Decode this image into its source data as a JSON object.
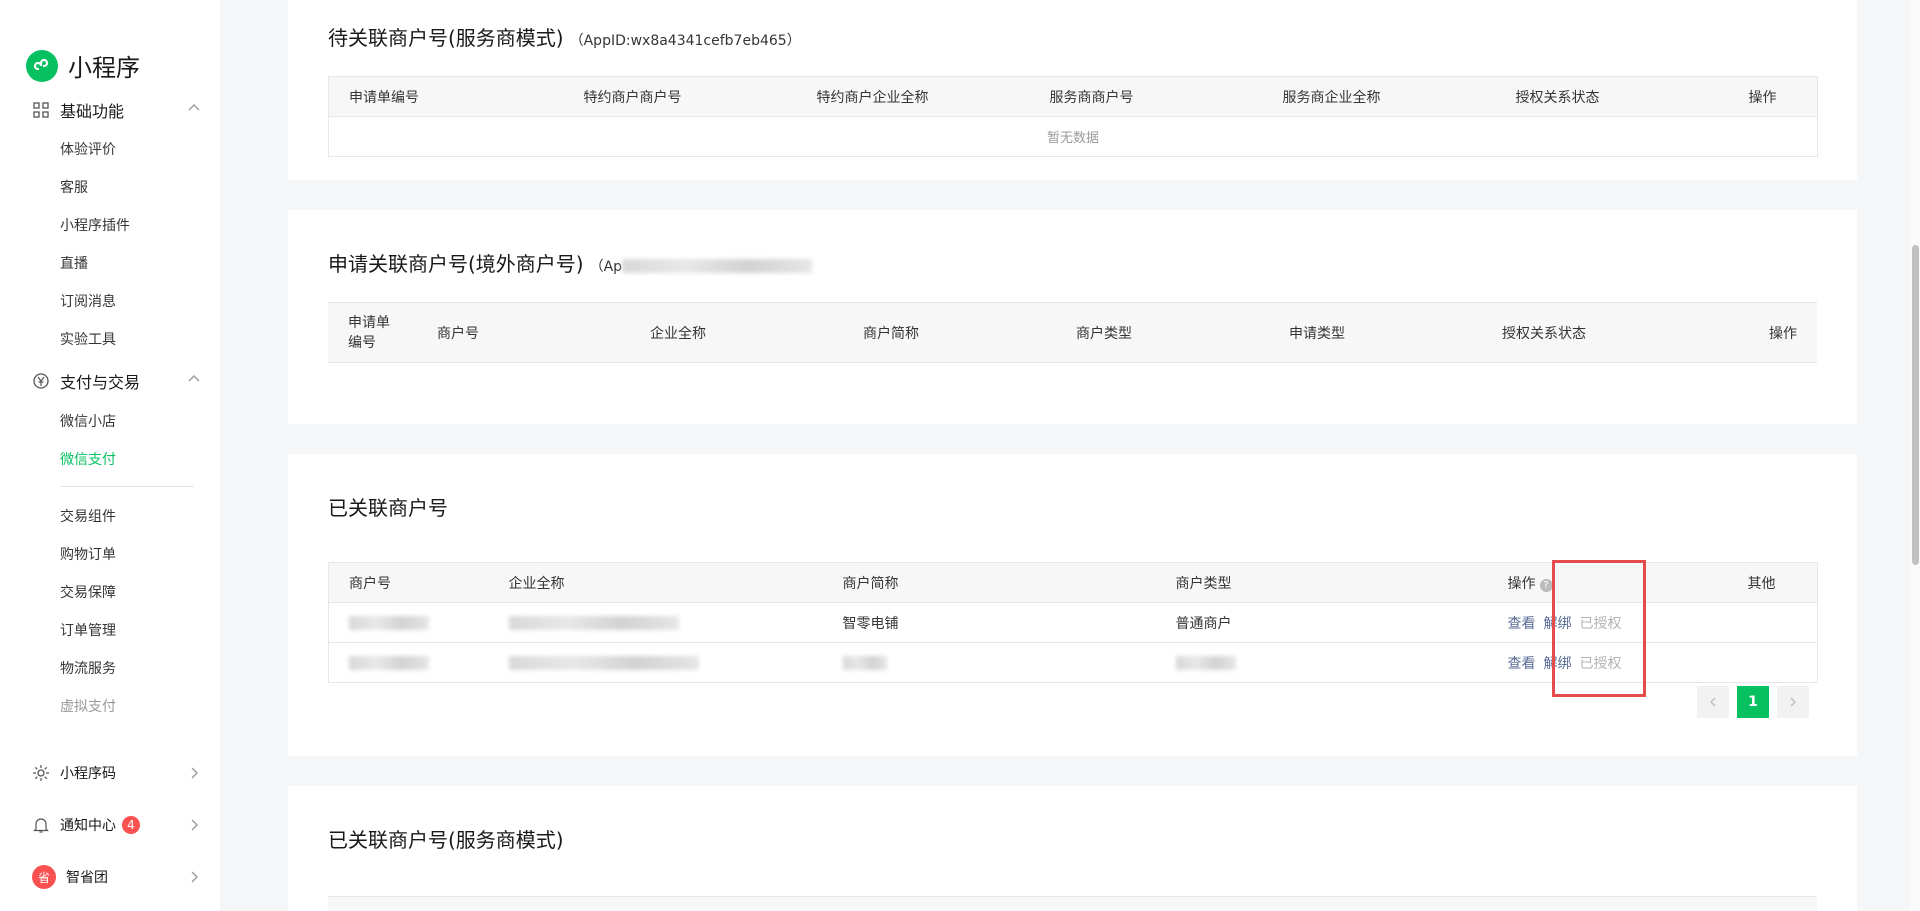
{
  "brand": {
    "title": "小程序"
  },
  "sidebar": {
    "group_basic": {
      "label": "基础功能",
      "items": [
        "体验评价",
        "客服",
        "小程序插件",
        "直播",
        "订阅消息",
        "实验工具"
      ]
    },
    "group_pay": {
      "label": "支付与交易",
      "items_top": [
        "微信小店",
        "微信支付"
      ],
      "items_bottom": [
        "交易组件",
        "购物订单",
        "交易保障",
        "订单管理",
        "物流服务",
        "虚拟支付"
      ]
    },
    "qrcode": {
      "label": "小程序码"
    },
    "notify": {
      "label": "通知中心",
      "count": "4"
    },
    "account": {
      "label": "智省团",
      "avatar_text": "省"
    }
  },
  "card1": {
    "title": "待关联商户号(服务商模式)",
    "appid": "（AppID:wx8a4341cefb7eb465）",
    "headers": [
      "申请单编号",
      "特约商户商户号",
      "特约商户企业全称",
      "服务商商户号",
      "服务商企业全称",
      "授权关系状态",
      "操作"
    ],
    "empty": "暂无数据"
  },
  "card2": {
    "title": "申请关联商户号(境外商户号)",
    "appid_prefix": "（Ap",
    "headers": [
      "申请单\n编号",
      "商户号",
      "企业全称",
      "商户简称",
      "商户类型",
      "申请类型",
      "授权关系状态",
      "操作"
    ]
  },
  "card3": {
    "title": "已关联商户号",
    "headers": [
      "商户号",
      "企业全称",
      "商户简称",
      "商户类型",
      "操作",
      "其他"
    ],
    "rows": [
      {
        "short_name": "智零电铺",
        "type": "普通商户",
        "view": "查看",
        "unbind": "解绑",
        "status": "已授权"
      },
      {
        "short_name": "",
        "type": "",
        "view": "查看",
        "unbind": "解绑",
        "status": "已授权"
      }
    ],
    "page": "1"
  },
  "card4": {
    "title": "已关联商户号(服务商模式)"
  }
}
